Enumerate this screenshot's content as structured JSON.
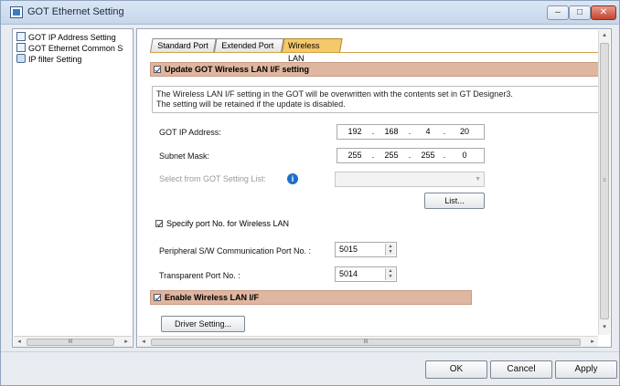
{
  "window": {
    "title": "GOT Ethernet Setting",
    "controls": {
      "minimize": "–",
      "maximize": "□",
      "close": "✕"
    }
  },
  "tree": {
    "items": [
      {
        "label": "GOT IP Address Setting",
        "icon": "network-setting-icon"
      },
      {
        "label": "GOT Ethernet Common S",
        "icon": "ethernet-common-icon"
      },
      {
        "label": "IP filter Setting",
        "icon": "ip-filter-icon"
      }
    ],
    "scroll_label": "III"
  },
  "tabs": [
    {
      "label": "Standard Port",
      "active": false
    },
    {
      "label": "Extended Port",
      "active": false
    },
    {
      "label": "Wireless LAN",
      "active": true
    }
  ],
  "wireless": {
    "update_label": "Update GOT Wireless LAN I/F setting",
    "update_checked": true,
    "info_line1": "The Wireless LAN I/F setting in the GOT will be overwritten with the contents set in GT Designer3.",
    "info_line2": "The setting will be retained if the update is disabled.",
    "ip_label": "GOT IP Address:",
    "ip": [
      "192",
      "168",
      "4",
      "20"
    ],
    "subnet_label": "Subnet Mask:",
    "subnet": [
      "255",
      "255",
      "255",
      "0"
    ],
    "select_label": "Select from GOT Setting List:",
    "select_value": "",
    "info_icon": "i",
    "list_button": "List...",
    "specify_port_label": "Specify port No. for Wireless LAN",
    "specify_port_checked": true,
    "peripheral_label": "Peripheral S/W Communication Port No. :",
    "peripheral_value": "5015",
    "transparent_label": "Transparent Port No. :",
    "transparent_value": "5014",
    "enable_label": "Enable Wireless LAN I/F",
    "enable_checked": true,
    "driver_button": "Driver Setting..."
  },
  "scrollbars": {
    "h_label": "III",
    "v_label": "≡"
  },
  "dialog": {
    "ok": "OK",
    "cancel": "Cancel",
    "apply": "Apply"
  },
  "colors": {
    "active_tab": "#f5c96a",
    "section_band": "#dfb6a0",
    "info_icon": "#1e6ec8"
  }
}
